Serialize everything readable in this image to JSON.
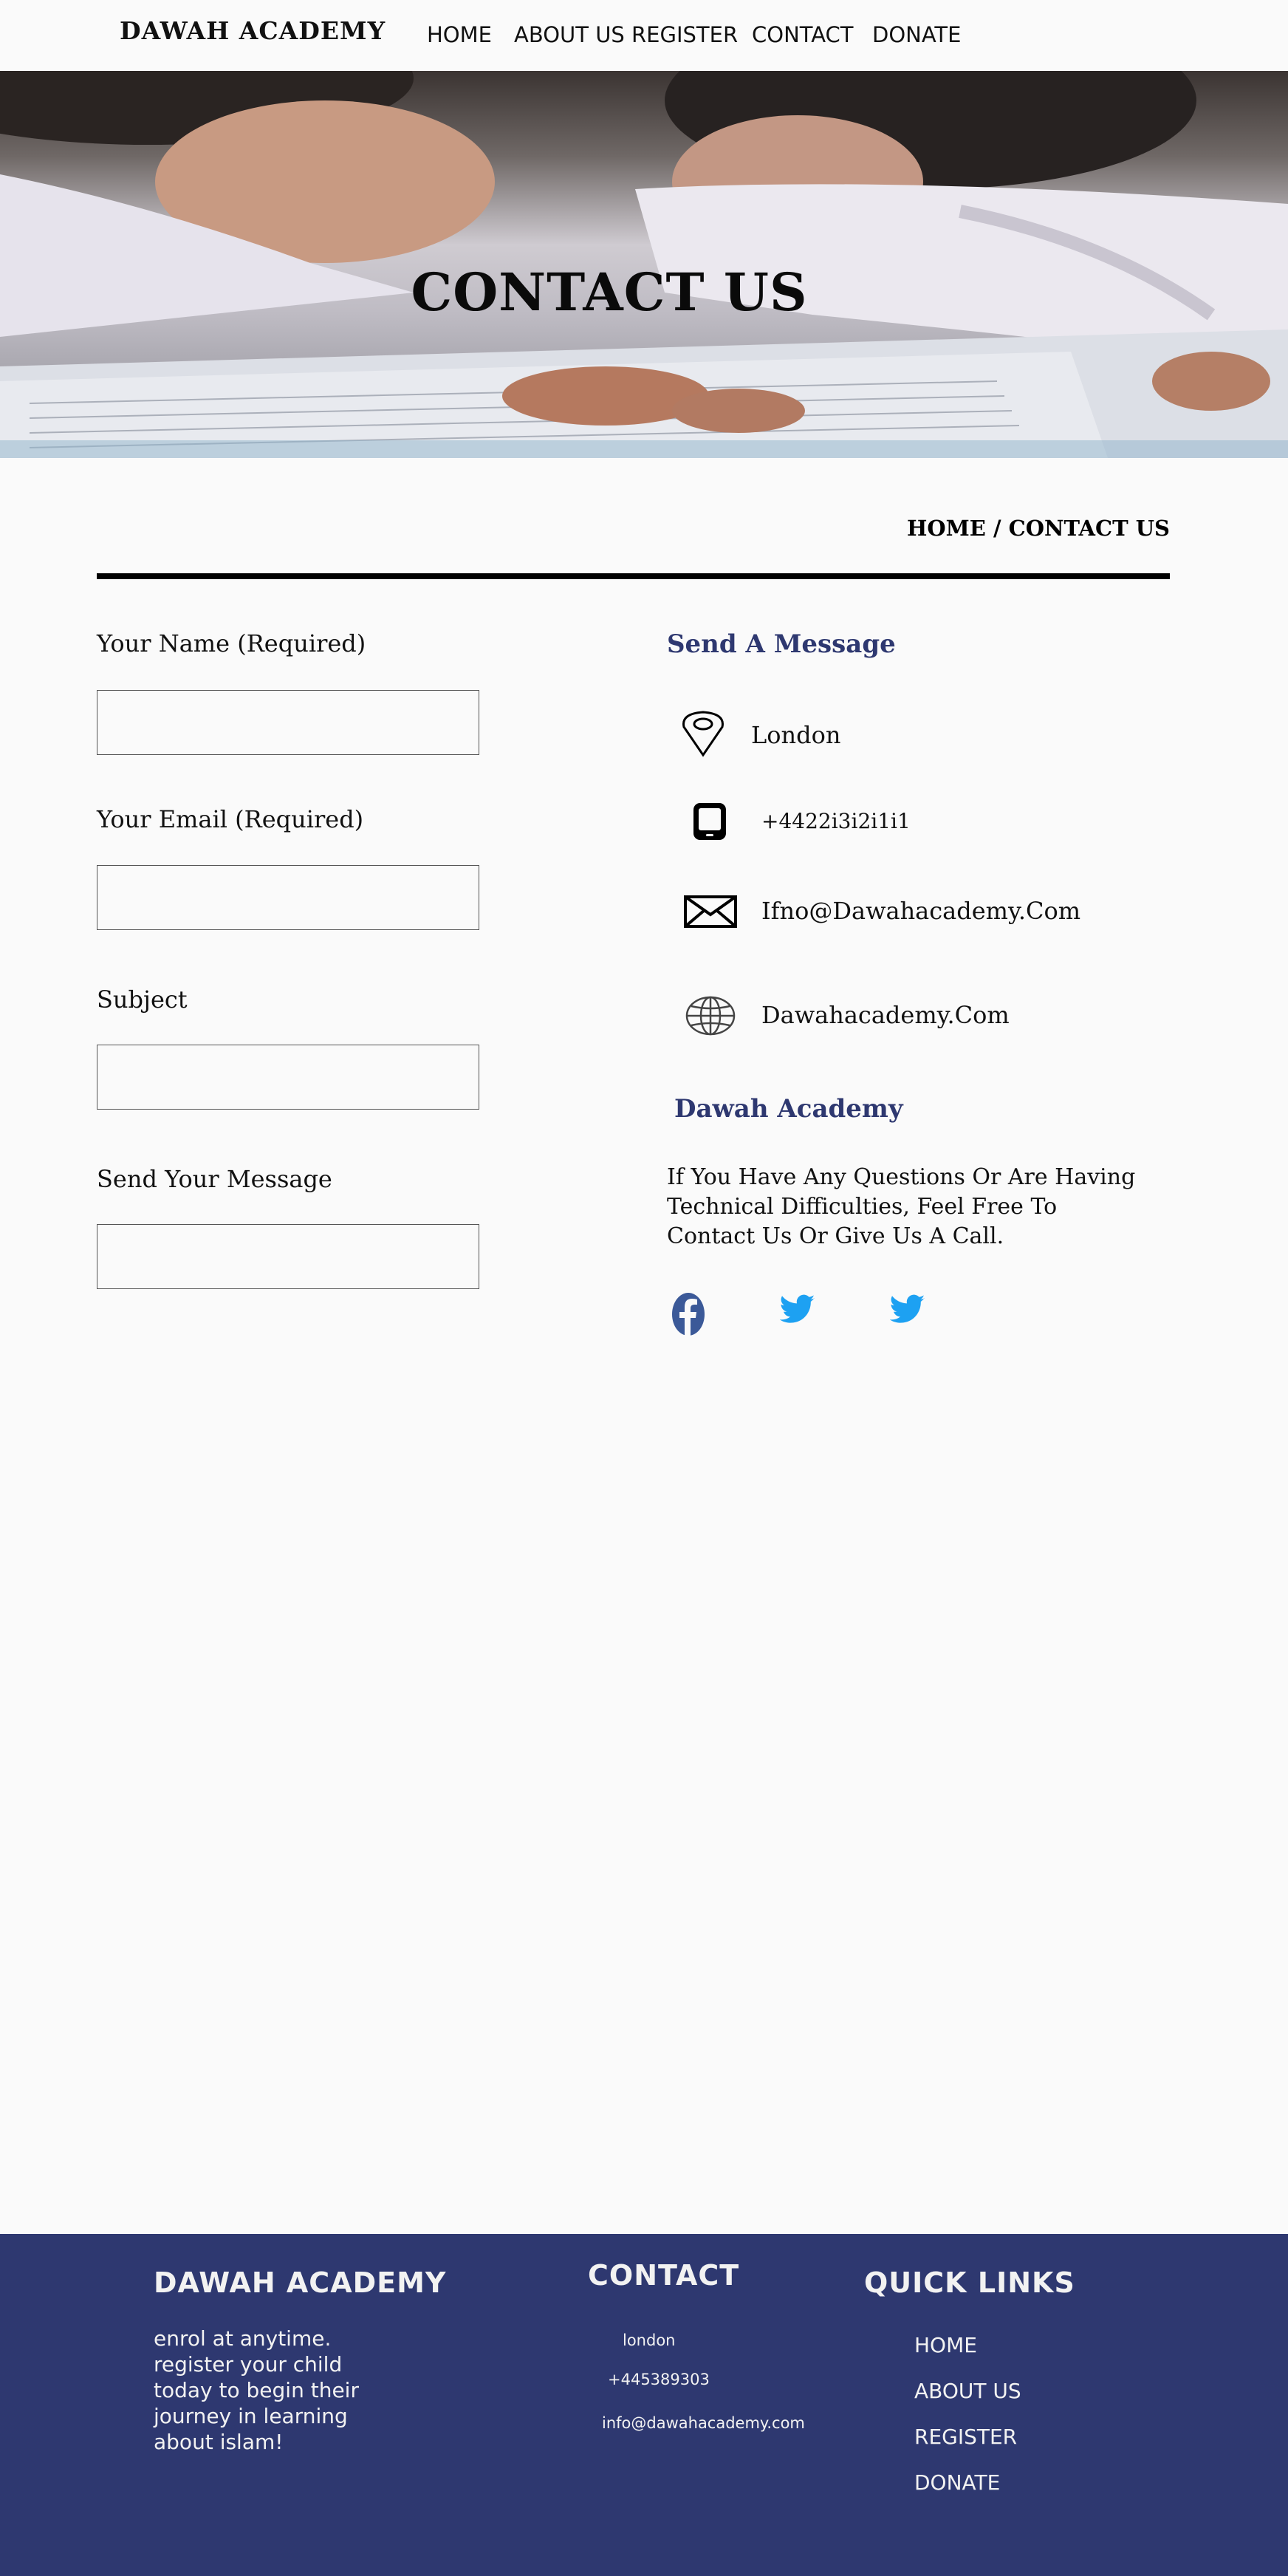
{
  "header": {
    "logo": "DAWAH ACADEMY",
    "nav": [
      "HOME",
      "ABOUT US",
      "REGISTER",
      "CONTACT",
      "DONATE"
    ]
  },
  "hero": {
    "title": "CONTACT US",
    "image": "children-reading-quran"
  },
  "breadcrumb": {
    "home": "HOME",
    "separator": " / ",
    "current": "CONTACT US"
  },
  "form": {
    "name_label": "Your Name (Required)",
    "email_label": "Your Email (Required)",
    "subject_label": "Subject",
    "message_label": "Send Your Message",
    "name_value": "",
    "email_value": "",
    "subject_value": "",
    "message_value": ""
  },
  "contact_info": {
    "heading": "Send A Message",
    "location": "London",
    "phone": "+4422i3i2i1i1",
    "email": "Ifno@Dawahacademy.Com",
    "website": "Dawahacademy.Com",
    "icons": [
      "location-pin-icon",
      "tablet-icon",
      "envelope-icon",
      "globe-icon"
    ]
  },
  "about": {
    "heading": "Dawah Academy",
    "text": "If You Have Any Questions Or Are Having Technical Difficulties, Feel Free To Contact Us Or Give Us A Call."
  },
  "social": [
    "facebook-icon",
    "twitter-icon",
    "twitter-icon"
  ],
  "footer": {
    "brand_title": "DAWAH ACADEMY",
    "tagline": "enrol at anytime. register your child today to begin their journey in learning about islam!",
    "contact_title": "CONTACT",
    "contact_location": "london",
    "contact_phone": "+445389303",
    "contact_email": "info@dawahacademy.com",
    "links_title": "QUICK LINKS",
    "links": [
      "HOME",
      "ABOUT US",
      "REGISTER",
      "DONATE"
    ]
  },
  "colors": {
    "accent": "#2e3870",
    "facebook": "#3b5998",
    "twitter": "#1da1f2",
    "background": "#fafafa"
  }
}
